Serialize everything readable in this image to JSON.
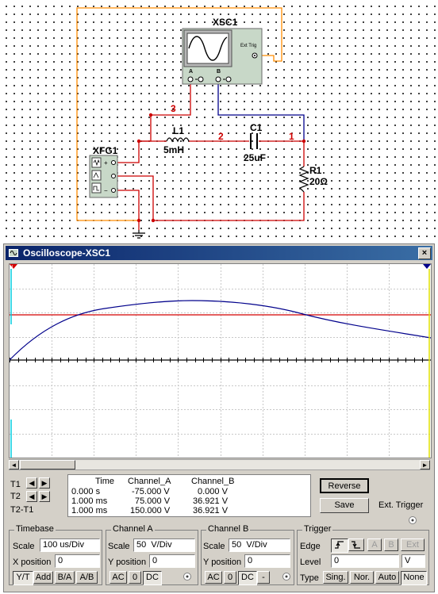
{
  "schematic": {
    "components": {
      "scope_name": "XSC1",
      "scope_ext_trig": "Ext Trig",
      "scope_a": "A",
      "scope_b": "B",
      "fg_name": "XFG1",
      "inductor_name": "L1",
      "inductor_value": "5mH",
      "capacitor_name": "C1",
      "capacitor_value": "25uF",
      "resistor_name": "R1",
      "resistor_value": "20Ω"
    },
    "nodes": {
      "n3": "3",
      "n2": "2",
      "n1": "1"
    },
    "colors": {
      "wire_red": "#cc0000",
      "wire_blue": "#00008b",
      "wire_orange": "#ff8c00"
    }
  },
  "scope_window": {
    "title": "Oscilloscope-XSC1",
    "close_glyph": "×",
    "scroll_left": "◄",
    "scroll_right": "►",
    "t1_label": "T1",
    "t2_label": "T2",
    "t2t1_label": "T2-T1",
    "readout": {
      "headers": [
        "Time",
        "Channel_A",
        "Channel_B"
      ],
      "rows": [
        [
          "0.000 s",
          "-75.000 V",
          "0.000 V"
        ],
        [
          "1.000 ms",
          "75.000 V",
          "36.921 V"
        ],
        [
          "1.000 ms",
          "150.000 V",
          "36.921 V"
        ]
      ]
    },
    "reverse_label": "Reverse",
    "save_label": "Save",
    "ext_trigger_label": "Ext. Trigger",
    "timebase": {
      "title": "Timebase",
      "scale_label": "Scale",
      "scale_value": "100 us/Div",
      "xpos_label": "X position",
      "xpos_value": "0",
      "modes": [
        "Y/T",
        "Add",
        "B/A",
        "A/B"
      ]
    },
    "channel_a": {
      "title": "Channel A",
      "scale_label": "Scale",
      "scale_value": "50  V/Div",
      "ypos_label": "Y position",
      "ypos_value": "0",
      "coupling": [
        "AC",
        "0",
        "DC"
      ]
    },
    "channel_b": {
      "title": "Channel B",
      "scale_label": "Scale",
      "scale_value": "50  V/Div",
      "ypos_label": "Y position",
      "ypos_value": "0",
      "coupling": [
        "AC",
        "0",
        "DC",
        "-"
      ]
    },
    "trigger": {
      "title": "Trigger",
      "edge_label": "Edge",
      "edge_buttons": [
        "A",
        "B",
        "Ext"
      ],
      "level_label": "Level",
      "level_value": "0",
      "level_unit": "V",
      "type_label": "Type",
      "types": [
        "Sing.",
        "Nor.",
        "Auto",
        "None"
      ]
    },
    "colors": {
      "channel_a_trace": "#d40000",
      "channel_b_trace": "#00008b",
      "cursor_t1": "#00ccdd",
      "cursor_t2": "#e0e000"
    }
  }
}
